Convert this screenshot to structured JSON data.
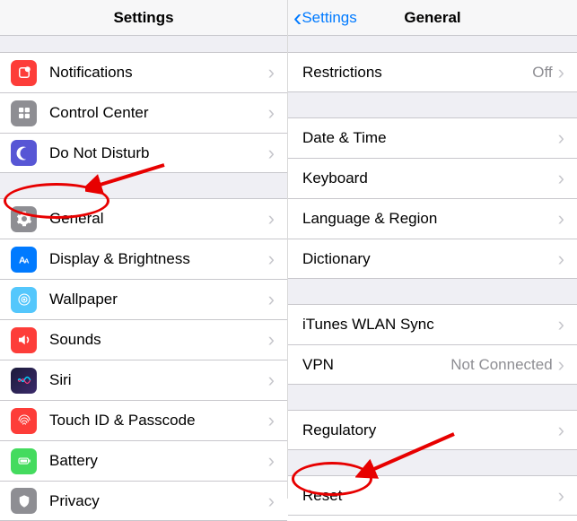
{
  "left": {
    "nav_title": "Settings",
    "group1": [
      {
        "label": "Notifications"
      },
      {
        "label": "Control Center"
      },
      {
        "label": "Do Not Disturb"
      }
    ],
    "group2": [
      {
        "label": "General"
      },
      {
        "label": "Display & Brightness"
      },
      {
        "label": "Wallpaper"
      },
      {
        "label": "Sounds"
      },
      {
        "label": "Siri"
      },
      {
        "label": "Touch ID & Passcode"
      },
      {
        "label": "Battery"
      },
      {
        "label": "Privacy"
      }
    ]
  },
  "right": {
    "nav_title": "General",
    "back_label": "Settings",
    "rows": {
      "restrictions": {
        "label": "Restrictions",
        "value": "Off"
      },
      "datetime": {
        "label": "Date & Time"
      },
      "keyboard": {
        "label": "Keyboard"
      },
      "lang": {
        "label": "Language & Region"
      },
      "dict": {
        "label": "Dictionary"
      },
      "itunes": {
        "label": "iTunes WLAN Sync"
      },
      "vpn": {
        "label": "VPN",
        "value": "Not Connected"
      },
      "regulatory": {
        "label": "Regulatory"
      },
      "reset": {
        "label": "Reset"
      }
    }
  },
  "colors": {
    "accent": "#007aff",
    "annotation": "#e70000"
  }
}
